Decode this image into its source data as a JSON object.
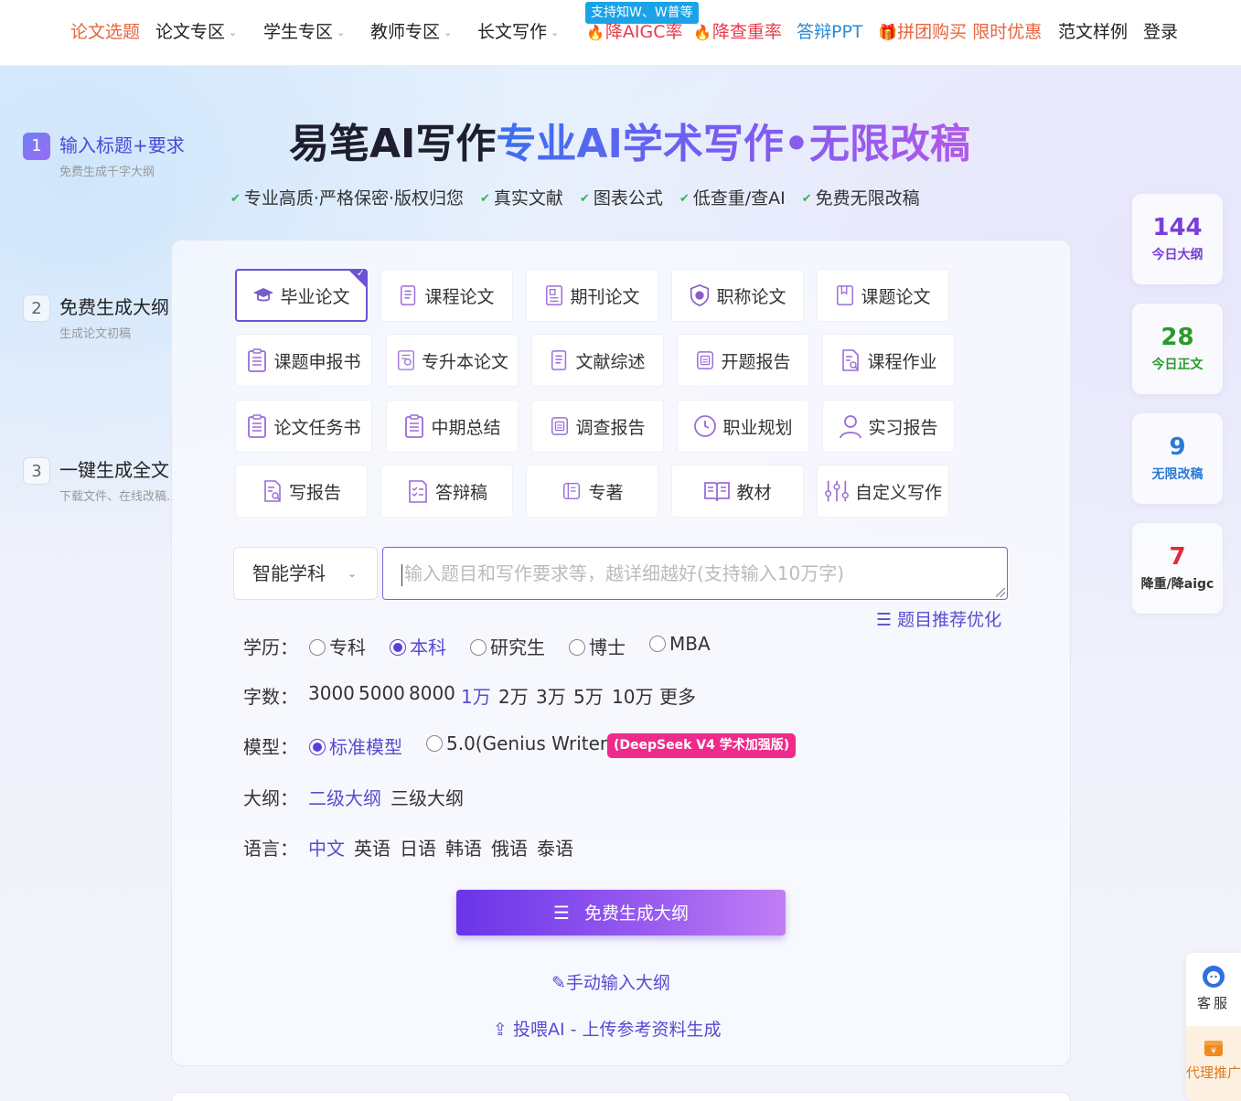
{
  "nav": {
    "items": [
      {
        "label": "论文选题",
        "has_dropdown": false
      },
      {
        "label": "论文专区",
        "has_dropdown": true
      },
      {
        "label": "学生专区",
        "has_dropdown": true
      },
      {
        "label": "教师专区",
        "has_dropdown": true
      },
      {
        "label": "长文写作",
        "has_dropdown": true
      },
      {
        "label": "降AIGC率"
      },
      {
        "label": "降查重率"
      },
      {
        "label": "答辩PPT"
      },
      {
        "label": "拼团购买 限时优惠"
      },
      {
        "label": "范文样例"
      },
      {
        "label": "登录"
      }
    ],
    "badge": "支持知W、W普等",
    "chevron": "⌄"
  },
  "steps": [
    {
      "num": "1",
      "title": "输入标题+要求",
      "sub": "免费生成千字大纲"
    },
    {
      "num": "2",
      "title": "免费生成大纲",
      "sub": "生成论文初稿"
    },
    {
      "num": "3",
      "title": "一键生成全文",
      "sub": "下载文件、在线改稿.."
    }
  ],
  "headline": {
    "dark": "易笔AI写作",
    "gradient": "专业AI学术写作•无限改稿"
  },
  "features": [
    "专业高质·严格保密·版权归您",
    "真实文献",
    "图表公式",
    "低查重/查AI",
    "免费无限改稿"
  ],
  "paper_types": [
    {
      "label": "毕业论文",
      "icon": "graduation-cap-icon",
      "selected": true
    },
    {
      "label": "课程论文",
      "icon": "document-icon"
    },
    {
      "label": "期刊论文",
      "icon": "journal-icon"
    },
    {
      "label": "职称论文",
      "icon": "shield-badge-icon"
    },
    {
      "label": "课题论文",
      "icon": "bookmark-doc-icon"
    },
    {
      "label": "课题申报书",
      "icon": "clipboard-icon"
    },
    {
      "label": "专升本论文",
      "icon": "certificate-icon"
    },
    {
      "label": "文献综述",
      "icon": "document-icon"
    },
    {
      "label": "开题报告",
      "icon": "report-icon"
    },
    {
      "label": "课程作业",
      "icon": "search-doc-icon"
    },
    {
      "label": "论文任务书",
      "icon": "clipboard-icon"
    },
    {
      "label": "中期总结",
      "icon": "clipboard-icon"
    },
    {
      "label": "调查报告",
      "icon": "report-icon"
    },
    {
      "label": "职业规划",
      "icon": "clock-icon"
    },
    {
      "label": "实习报告",
      "icon": "user-icon"
    },
    {
      "label": "写报告",
      "icon": "search-doc-icon"
    },
    {
      "label": "答辩稿",
      "icon": "checklist-icon"
    },
    {
      "label": "专著",
      "icon": "book-icon"
    },
    {
      "label": "教材",
      "icon": "open-book-icon"
    },
    {
      "label": "自定义写作",
      "icon": "sliders-icon"
    }
  ],
  "subject_select": {
    "value": "智能学科"
  },
  "prompt": {
    "placeholder": "输入题目和写作要求等，越详细越好(支持输入10万字)"
  },
  "optimize_link": "题目推荐优化",
  "education": {
    "label": "学历：",
    "options": [
      "专科",
      "本科",
      "研究生",
      "博士",
      "MBA"
    ],
    "selected": "本科"
  },
  "wordcount": {
    "label": "字数：",
    "options": [
      "3000",
      "5000",
      "8000",
      "1万",
      "2万",
      "3万",
      "5万",
      "10万",
      "更多"
    ],
    "selected": "1万"
  },
  "model": {
    "label": "模型：",
    "options": [
      "标准模型",
      "5.0(Genius Writer)"
    ],
    "selected": "标准模型",
    "badge": "(DeepSeek V4 学术加强版)"
  },
  "outline": {
    "label": "大纲：",
    "options": [
      "二级大纲",
      "三级大纲"
    ],
    "selected": "二级大纲"
  },
  "language": {
    "label": "语言：",
    "options": [
      "中文",
      "英语",
      "日语",
      "韩语",
      "俄语",
      "泰语"
    ],
    "selected": "中文"
  },
  "generate_button": "免费生成大纲",
  "manual_link": "手动输入大纲",
  "upload_link": "投喂AI - 上传参考资料生成",
  "stats": [
    {
      "num": "144",
      "label": "今日大纲",
      "color": "#7a3fd8"
    },
    {
      "num": "28",
      "label": "今日正文",
      "color": "#2a9a2a"
    },
    {
      "num": "9",
      "label": "无限改稿",
      "color": "#2a7ad8"
    },
    {
      "num": "7",
      "label": "降重/降aigc",
      "color": "#e02a3a",
      "label_color": "#333"
    }
  ],
  "side_float": {
    "service": "客服",
    "agent": "代理推广"
  },
  "colors": {
    "accent": "#5a4ad0",
    "brand_purple": "#6b52d6"
  }
}
